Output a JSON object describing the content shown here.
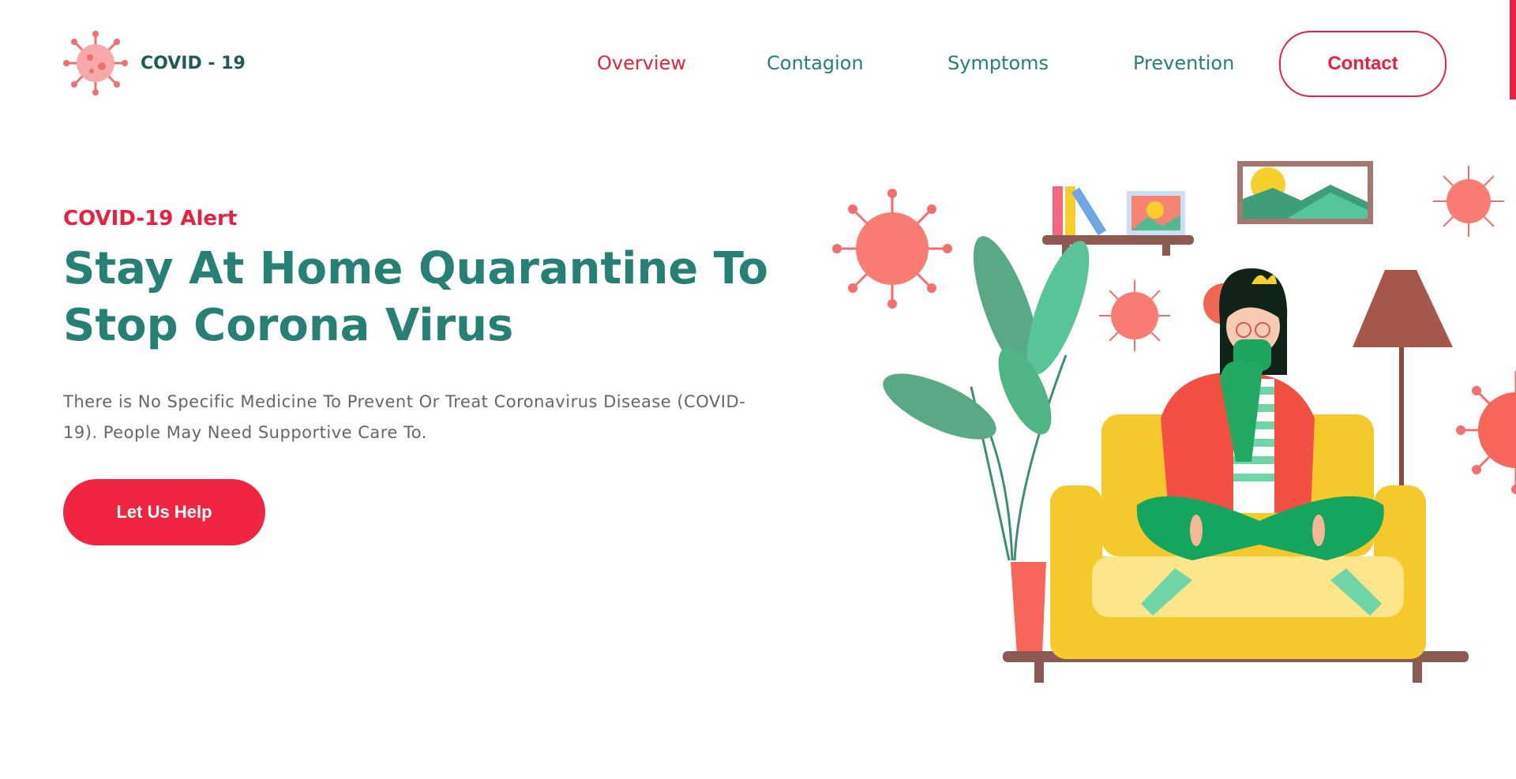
{
  "brand": {
    "name": "COVID - 19",
    "logo_icon": "virus-icon",
    "accent": "#e8213f",
    "primary": "#268073"
  },
  "nav": {
    "items": [
      {
        "label": "Overview",
        "active": true
      },
      {
        "label": "Contagion",
        "active": false
      },
      {
        "label": "Symptoms",
        "active": false
      },
      {
        "label": "Prevention",
        "active": false
      }
    ],
    "contact_label": "Contact"
  },
  "hero": {
    "eyebrow": "COVID-19 Alert",
    "title": "Stay At Home Quarantine To Stop Corona Virus",
    "description": "There is No Specific Medicine To Prevent Or Treat Coronavirus Disease (COVID-19). People May Need Supportive Care To.",
    "cta_label": "Let Us Help"
  },
  "illustration": {
    "icons": [
      "virus-icon",
      "bookshelf-icon",
      "framed-picture-icon",
      "plant-icon",
      "lamp-icon",
      "sofa-icon",
      "masked-woman-icon"
    ]
  }
}
